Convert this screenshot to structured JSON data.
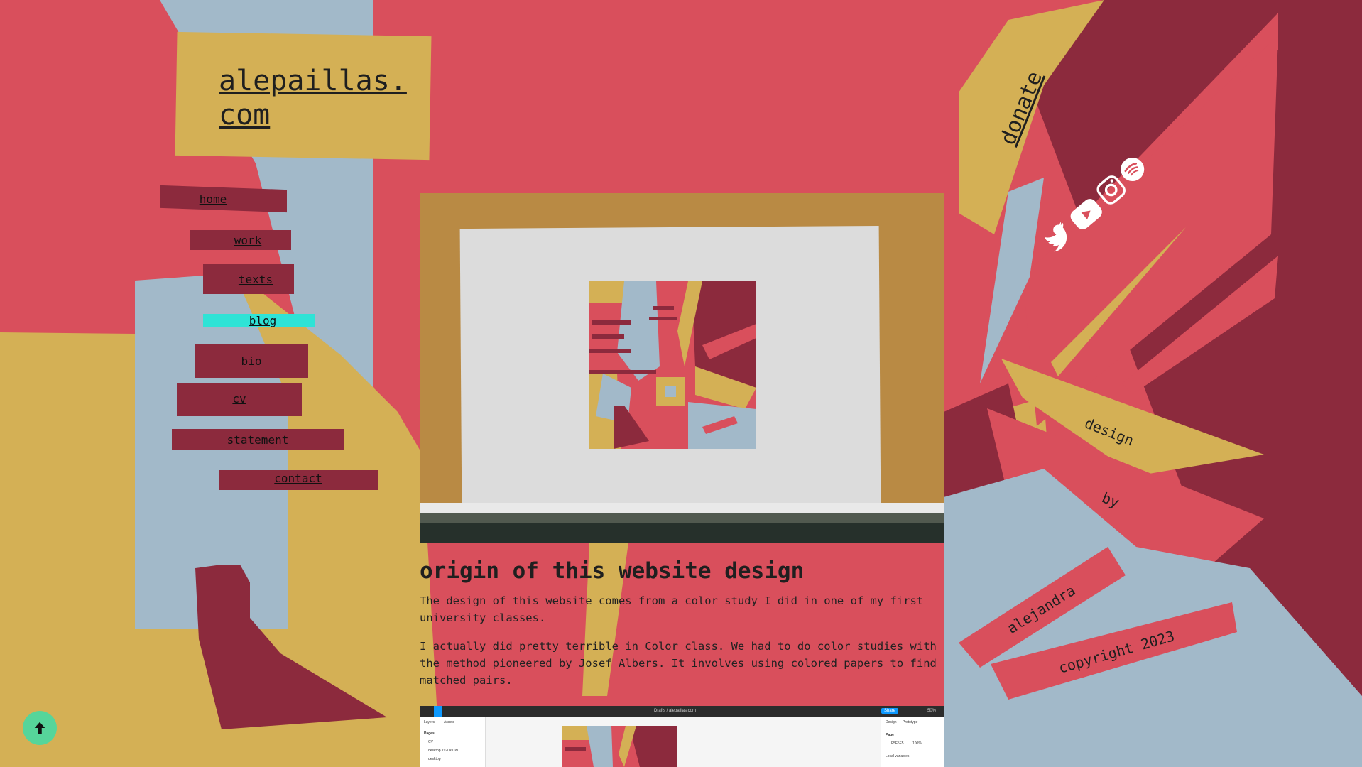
{
  "site": {
    "logo": "alepaillas.com"
  },
  "nav": {
    "items": [
      {
        "label": "home"
      },
      {
        "label": "work"
      },
      {
        "label": "texts"
      },
      {
        "label": "blog",
        "active": true
      },
      {
        "label": "bio"
      },
      {
        "label": "cv"
      },
      {
        "label": "statement"
      },
      {
        "label": "contact"
      }
    ]
  },
  "article": {
    "title": "origin of this website design",
    "paragraphs": [
      "The design of this website comes from a color study I did in one of my first university classes.",
      "I actually did pretty terrible in Color class. We had to do color studies with the method pioneered by Josef Albers. It involves using colored papers to find matched pairs."
    ]
  },
  "figma_preview": {
    "doc_title": "Drafts / alepaillas.com",
    "share_label": "Share",
    "zoom": "50%",
    "tabs": [
      "Layers",
      "Assets"
    ],
    "pages_label": "Pages",
    "pages": [
      "CV",
      "desktop 1920×1080",
      "desktop"
    ],
    "design_tabs": [
      "Design",
      "Prototype"
    ],
    "page_section": "Page",
    "page_color": "F5F5F5",
    "page_opacity": "100%",
    "local_variables": "Local variables"
  },
  "side": {
    "donate": "donate",
    "social": [
      {
        "icon": "twitter-icon"
      },
      {
        "icon": "youtube-icon"
      },
      {
        "icon": "instagram-icon"
      },
      {
        "icon": "spotify-icon"
      }
    ],
    "credits": [
      "design",
      "by",
      "alejandra",
      "copyright 2023"
    ]
  },
  "colors": {
    "coral": "#d94f5c",
    "maroon": "#8c2a3d",
    "mustard": "#d4b055",
    "blue_gray": "#a2b9c9",
    "active_nav": "#2ee3d6",
    "scroll_button": "#56d59a"
  }
}
